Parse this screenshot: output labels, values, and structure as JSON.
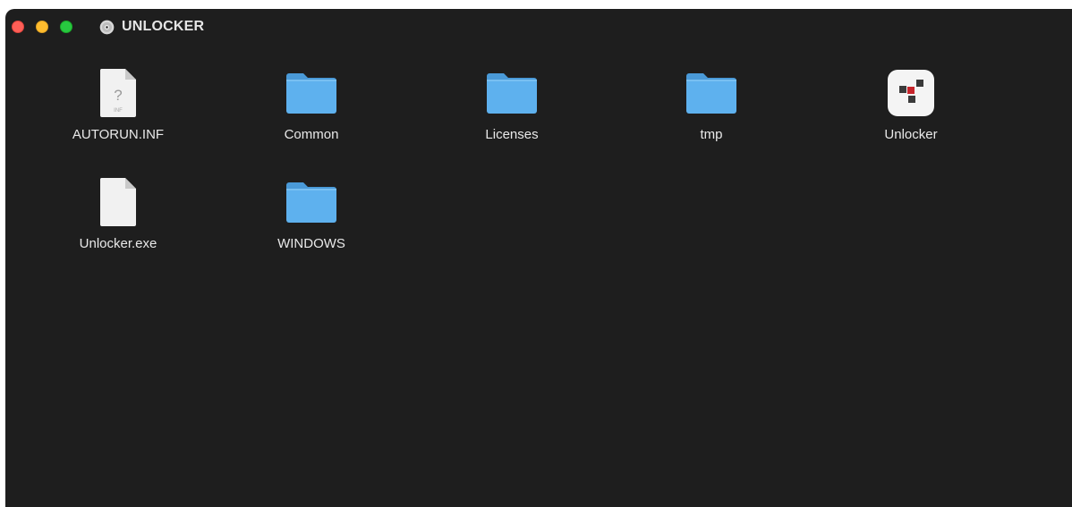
{
  "window": {
    "title": "UNLOCKER"
  },
  "items": [
    {
      "label": "AUTORUN.INF",
      "icon": "inf-document-icon"
    },
    {
      "label": "Common",
      "icon": "folder-icon"
    },
    {
      "label": "Licenses",
      "icon": "folder-icon"
    },
    {
      "label": "tmp",
      "icon": "folder-icon"
    },
    {
      "label": "Unlocker",
      "icon": "app-icon"
    },
    {
      "label": "Unlocker.exe",
      "icon": "document-icon"
    },
    {
      "label": "WINDOWS",
      "icon": "folder-icon"
    }
  ],
  "doc_badges": {
    "inf_mark": "?",
    "inf_ext": "INF"
  },
  "colors": {
    "window_bg": "#1e1e1e",
    "folder": "#5eb1ee",
    "folder_tab": "#4a9ad8",
    "close": "#fe5f57",
    "minimize": "#febc2e",
    "maximize": "#28c840"
  }
}
